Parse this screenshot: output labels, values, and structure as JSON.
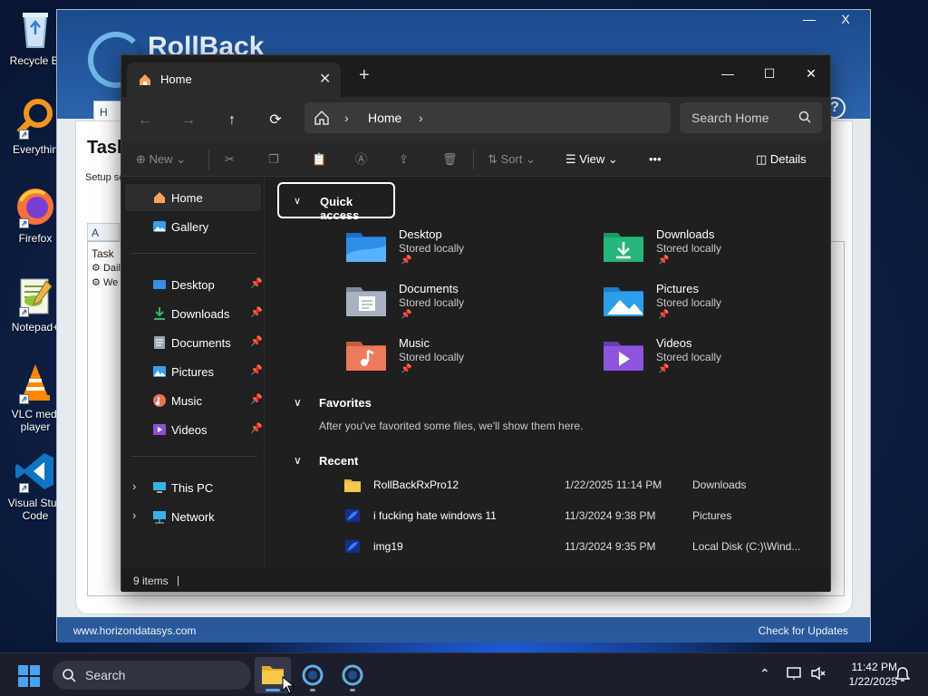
{
  "desktop": {
    "icons": [
      {
        "label": "Recycle Bi",
        "icon": "recycle-bin-icon"
      },
      {
        "label": "Everythin",
        "icon": "everything-search-icon"
      },
      {
        "label": "Firefox",
        "icon": "firefox-icon"
      },
      {
        "label": "Notepad+",
        "icon": "notepad-plus-icon"
      },
      {
        "label": "VLC medi\nplayer",
        "icon": "vlc-icon"
      },
      {
        "label": "Visual Stud\nCode",
        "icon": "vscode-icon"
      }
    ]
  },
  "rollback": {
    "title": "RollBack",
    "tab_label": "H",
    "heading": "Task",
    "subtext": "Setup sc",
    "list_tab": "A",
    "column_task": "Task",
    "rows": [
      "Dail",
      "We"
    ],
    "help": "?",
    "close": "X",
    "footer_left": "www.horizondatasys.com",
    "footer_right": "Check for Updates"
  },
  "explorer": {
    "tab_title": "Home",
    "address": {
      "root_icon": "home-icon",
      "segment": "Home"
    },
    "search_placeholder": "Search Home",
    "toolbar": {
      "new_label": "New",
      "sort_label": "Sort",
      "view_label": "View",
      "more_label": "•••",
      "details_label": "Details"
    },
    "sidebar": {
      "home": "Home",
      "gallery": "Gallery",
      "pinned": [
        {
          "label": "Desktop",
          "icon": "desktop-folder-icon",
          "color": "#3a8ee6"
        },
        {
          "label": "Downloads",
          "icon": "download-icon",
          "color": "#2fb86a"
        },
        {
          "label": "Documents",
          "icon": "documents-icon",
          "color": "#9aa6b4"
        },
        {
          "label": "Pictures",
          "icon": "pictures-icon",
          "color": "#3aa0e8"
        },
        {
          "label": "Music",
          "icon": "music-icon",
          "color": "#e8735a"
        },
        {
          "label": "Videos",
          "icon": "videos-icon",
          "color": "#8a52d6"
        }
      ],
      "this_pc": "This PC",
      "network": "Network"
    },
    "quick_access": {
      "header": "Quick access",
      "tiles": [
        {
          "name": "Desktop",
          "sub": "Stored locally",
          "color": "#2f8ee8"
        },
        {
          "name": "Downloads",
          "sub": "Stored locally",
          "color": "#26b57a"
        },
        {
          "name": "Documents",
          "sub": "Stored locally",
          "color": "#a7b3c1"
        },
        {
          "name": "Pictures",
          "sub": "Stored locally",
          "color": "#2f9ee8"
        },
        {
          "name": "Music",
          "sub": "Stored locally",
          "color": "#ec7a5c"
        },
        {
          "name": "Videos",
          "sub": "Stored locally",
          "color": "#8d55dc"
        }
      ]
    },
    "favorites": {
      "header": "Favorites",
      "note": "After you've favorited some files, we'll show them here."
    },
    "recent": {
      "header": "Recent",
      "rows": [
        {
          "name": "RollBackRxPro12",
          "date": "1/22/2025 11:14 PM",
          "location": "Downloads",
          "icon": "folder-icon"
        },
        {
          "name": "i fucking hate windows 11",
          "date": "11/3/2024 9:38 PM",
          "location": "Pictures",
          "icon": "image-file-icon"
        },
        {
          "name": "img19",
          "date": "11/3/2024 9:35 PM",
          "location": "Local Disk (C:)\\Wind...",
          "icon": "image-file-icon"
        }
      ]
    },
    "status": "9 items"
  },
  "taskbar": {
    "search_label": "Search",
    "time": "11:42 PM",
    "date": "1/22/2025"
  }
}
